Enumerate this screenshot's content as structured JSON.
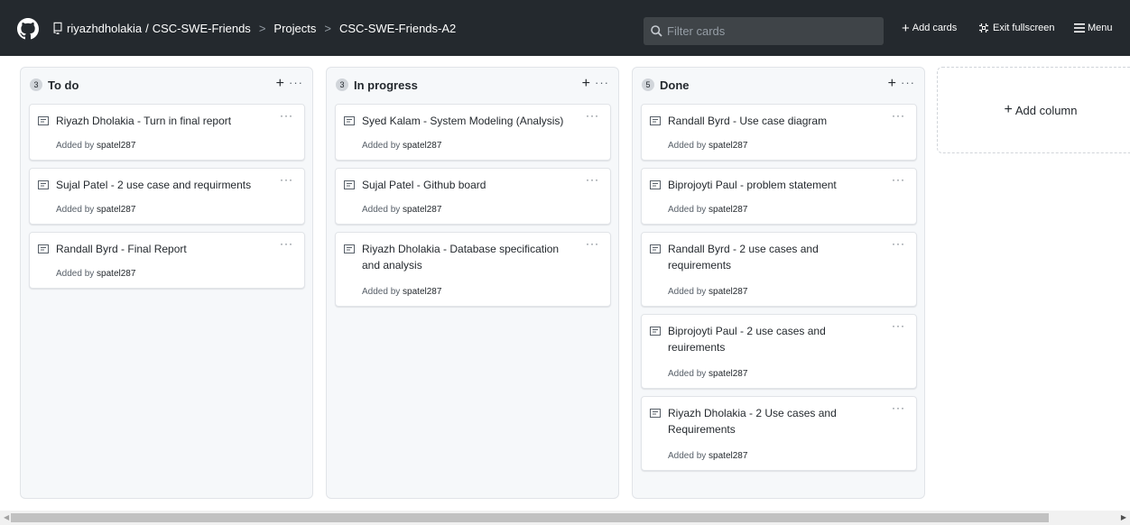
{
  "header": {
    "owner": "riyazhdholakia",
    "slash": "/",
    "repo": "CSC-SWE-Friends",
    "sep1": ">",
    "projects": "Projects",
    "sep2": ">",
    "project": "CSC-SWE-Friends-A2",
    "filter_placeholder": "Filter cards",
    "add_cards": "Add cards",
    "exit_fullscreen": "Exit fullscreen",
    "menu": "Menu",
    "colors": {
      "bg": "#24292e"
    }
  },
  "columns": [
    {
      "count": "3",
      "title": "To do",
      "cards": [
        {
          "title": "Riyazh Dholakia - Turn in final report",
          "added_by": "Added by",
          "user": "spatel287"
        },
        {
          "title": "Sujal Patel - 2 use case and requirments",
          "added_by": "Added by",
          "user": "spatel287"
        },
        {
          "title": "Randall Byrd - Final Report",
          "added_by": "Added by",
          "user": "spatel287"
        }
      ]
    },
    {
      "count": "3",
      "title": "In progress",
      "cards": [
        {
          "title": "Syed Kalam - System Modeling (Analysis)",
          "added_by": "Added by",
          "user": "spatel287"
        },
        {
          "title": "Sujal Patel - Github board",
          "added_by": "Added by",
          "user": "spatel287"
        },
        {
          "title": "Riyazh Dholakia - Database specification and analysis",
          "added_by": "Added by",
          "user": "spatel287"
        }
      ]
    },
    {
      "count": "5",
      "title": "Done",
      "cards": [
        {
          "title": "Randall Byrd - Use case diagram",
          "added_by": "Added by",
          "user": "spatel287"
        },
        {
          "title": "Biprojoyti Paul - problem statement",
          "added_by": "Added by",
          "user": "spatel287"
        },
        {
          "title": "Randall Byrd - 2 use cases and requirements",
          "added_by": "Added by",
          "user": "spatel287"
        },
        {
          "title": "Biprojoyti Paul - 2 use cases and reuirements",
          "added_by": "Added by",
          "user": "spatel287"
        },
        {
          "title": "Riyazh Dholakia - 2 Use cases and Requirements",
          "added_by": "Added by",
          "user": "spatel287"
        }
      ]
    }
  ],
  "add_column": "Add column",
  "icons": {
    "plus": "+",
    "more": "···"
  }
}
